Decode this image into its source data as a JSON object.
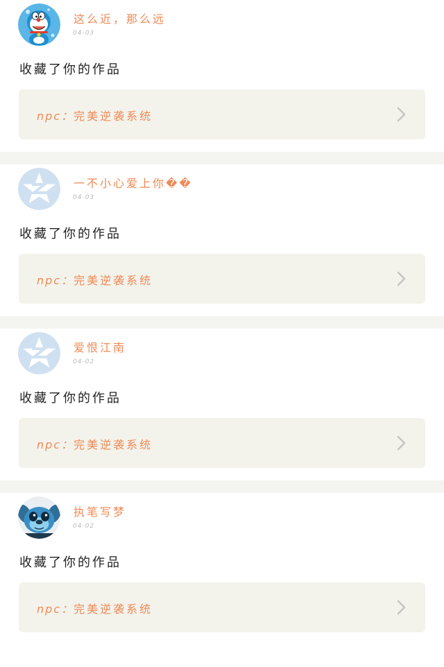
{
  "feed": {
    "items": [
      {
        "username": "这么近，那么远",
        "date": "04-03",
        "action": "收藏了你的作品",
        "work_prefix": "npc：",
        "work_title": "完美逆袭系统",
        "avatar_icon": "doraemon-avatar-icon"
      },
      {
        "username": "一不小心爱上你��",
        "date": "04-03",
        "action": "收藏了你的作品",
        "work_prefix": "npc：",
        "work_title": "完美逆袭系统",
        "avatar_icon": "qzone-default-avatar-icon"
      },
      {
        "username": "爱恨江南",
        "date": "04-02",
        "action": "收藏了你的作品",
        "work_prefix": "npc：",
        "work_title": "完美逆袭系统",
        "avatar_icon": "qzone-default-avatar-icon"
      },
      {
        "username": "执笔写梦",
        "date": "04-02",
        "action": "收藏了你的作品",
        "work_prefix": "npc：",
        "work_title": "完美逆袭系统",
        "avatar_icon": "stitch-avatar-icon"
      }
    ]
  },
  "colors": {
    "accent": "#ef8a55",
    "action_text": "#222222",
    "date_text": "#b8b8b8",
    "work_card_bg": "#f3f3ec",
    "separator": "#f4f4f0",
    "chevron": "#c4c4c4"
  }
}
